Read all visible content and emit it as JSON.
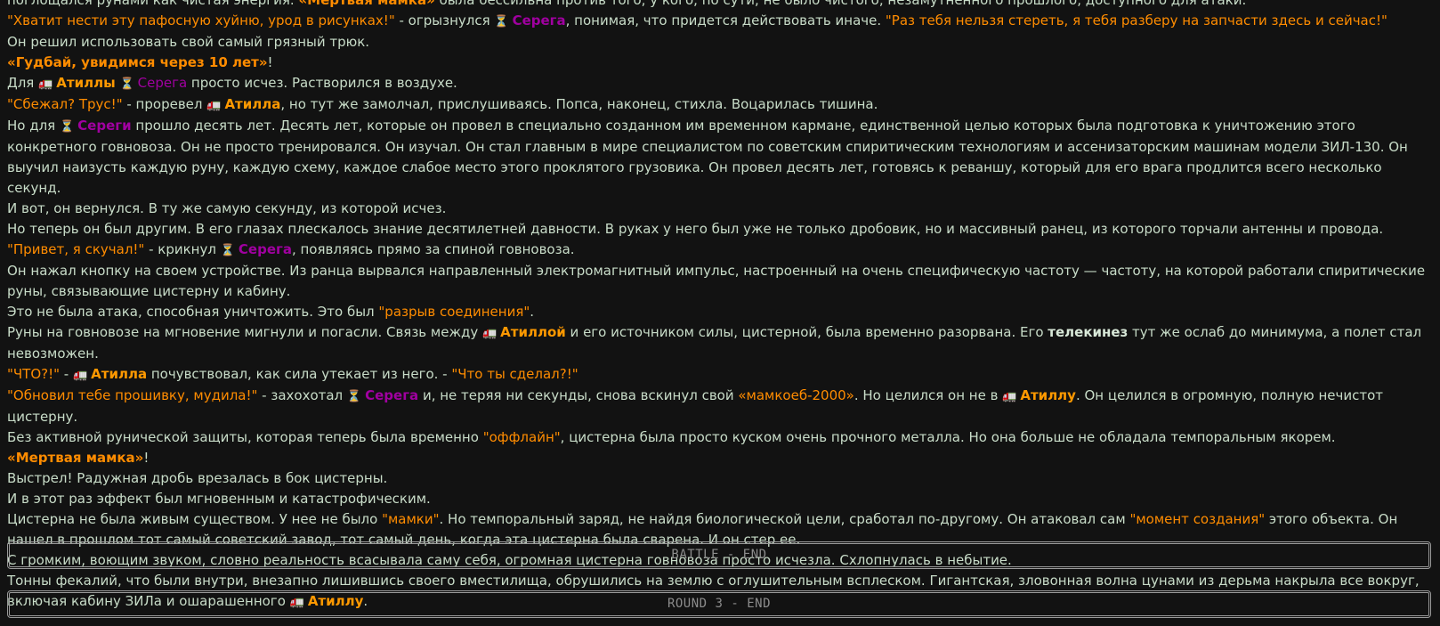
{
  "characters": {
    "serega": {
      "name": "Серега",
      "name_gen": "Сереги",
      "icon": "hourglass-icon"
    },
    "atilla": {
      "name": "Атилла",
      "name_gen": "Атиллы",
      "name_instr": "Атиллой",
      "name_acc": "Атиллу",
      "icon": "truck-icon"
    }
  },
  "colors": {
    "background": "#121212",
    "text": "#c8dcc8",
    "quote": "#ff8c00",
    "serega": "#a000a0",
    "atilla": "#ff9900",
    "separator_border": "#9a9a9a"
  },
  "log": {
    "l1": {
      "t1": "поглощался рунами как чистая энергия. ",
      "q1": "«Мертвая мамка»",
      "t2": " была бессильна против того, у кого, по сути, не было чистого, незамутненного прошлого, доступного для атаки."
    },
    "l2": {
      "q1": "\"Хватит нести эту пафосную хуйню, урод в рисунках!\"",
      "t1": " - огрызнулся ",
      "t2": ", понимая, что придется действовать иначе. ",
      "q2": "\"Раз тебя нельзя стереть, я тебя разберу на запчасти здесь и сейчас!\""
    },
    "l3": "Он решил использовать свой самый грязный трюк.",
    "l4": {
      "q1": "«Гудбай, увидимся через 10 лет»",
      "t1": "!"
    },
    "l5": {
      "t1": "Для ",
      "t2": " ",
      "t3": " просто исчез. Растворился в воздухе."
    },
    "l6": {
      "q1": "\"Сбежал? Трус!\"",
      "t1": " - проревел ",
      "t2": ", но тут же замолчал, прислушиваясь. Попса, наконец, стихла. Воцарилась тишина."
    },
    "l7": {
      "t1": "Но для ",
      "t2": " прошло десять лет. Десять лет, которые он провел в специально созданном им временном кармане, единственной целью которых была подготовка к уничтожению этого конкретного говновоза. Он не просто тренировался. Он изучал. Он стал главным в мире специалистом по советским спиритическим технологиям и ассенизаторским машинам модели ЗИЛ-130. Он выучил наизусть каждую руну, каждую схему, каждое слабое место этого проклятого грузовика. Он провел десять лет, готовясь к реваншу, который для его врага продлится всего несколько секунд."
    },
    "l8": "И вот, он вернулся. В ту же самую секунду, из которой исчез.",
    "l9": "Но теперь он был другим. В его глазах плескалось знание десятилетней давности. В руках у него был уже не только дробовик, но и массивный ранец, из которого торчали антенны и провода.",
    "l10": {
      "q1": "\"Привет, я скучал!\"",
      "t1": " - крикнул ",
      "t2": ", появляясь прямо за спиной говновоза."
    },
    "l11": "Он нажал кнопку на своем устройстве. Из ранца вырвался направленный электромагнитный импульс, настроенный на очень специфическую частоту — частоту, на которой работали спиритические руны, связывающие цистерну и кабину.",
    "l12": {
      "t1": "Это не была атака, способная уничтожить. Это был ",
      "q1": "\"разрыв соединения\"",
      "t2": "."
    },
    "l13": {
      "t1": "Руны на говновозе на мгновение мигнули и погасли. Связь между ",
      "t2": " и его источником силы, цистерной, была временно разорвана. Его ",
      "b1": "телекинез",
      "t3": " тут же ослаб до минимума, а полет стал невозможен."
    },
    "l14": {
      "q1": "\"ЧТО?!\"",
      "t1": " - ",
      "t2": " почувствовал, как сила утекает из него. - ",
      "q2": "\"Что ты сделал?!\""
    },
    "l15": {
      "q1": "\"Обновил тебе прошивку, мудила!\"",
      "t1": " - захохотал ",
      "t2": " и, не теряя ни секунды, снова вскинул свой ",
      "q2": "«мамкоеб-2000»",
      "t3": ". Но целился он не в ",
      "t4": ". Он целился в огромную, полную нечистот цистерну."
    },
    "l16": {
      "t1": "Без активной рунической защиты, которая теперь была временно ",
      "q1": "\"оффлайн\"",
      "t2": ", цистерна была просто куском очень прочного металла. Но она больше не обладала темпоральным якорем."
    },
    "l17": {
      "q1": "«Мертвая мамка»",
      "t1": "!"
    },
    "l18": "Выстрел! Радужная дробь врезалась в бок цистерны.",
    "l19": "И в этот раз эффект был мгновенным и катастрофическим.",
    "l20": {
      "t1": "Цистерна не была живым существом. У нее не было ",
      "q1": "\"мамки\"",
      "t2": ". Но темпоральный заряд, не найдя биологической цели, сработал по-другому. Он атаковал сам ",
      "q2": "\"момент создания\"",
      "t3": " этого объекта. Он нашел в прошлом тот самый советский завод, тот самый день, когда эта цистерна была сварена. И он стер ее."
    },
    "l21": "С громким, воющим звуком, словно реальность всасывала саму себя, огромная цистерна говновоза просто исчезла. Схлопнулась в небытие.",
    "l22": {
      "t1": "Тонны фекалий, что были внутри, внезапно лишившись своего вместилища, обрушились на землю с оглушительным всплеском. Гигантская, зловонная волна цунами из дерьма накрыла все вокруг, включая кабину ЗИЛа и ошарашенного ",
      "t2": "."
    }
  },
  "separators": {
    "battle_end": "BATTLE - END",
    "round_end": "ROUND 3 - END"
  }
}
